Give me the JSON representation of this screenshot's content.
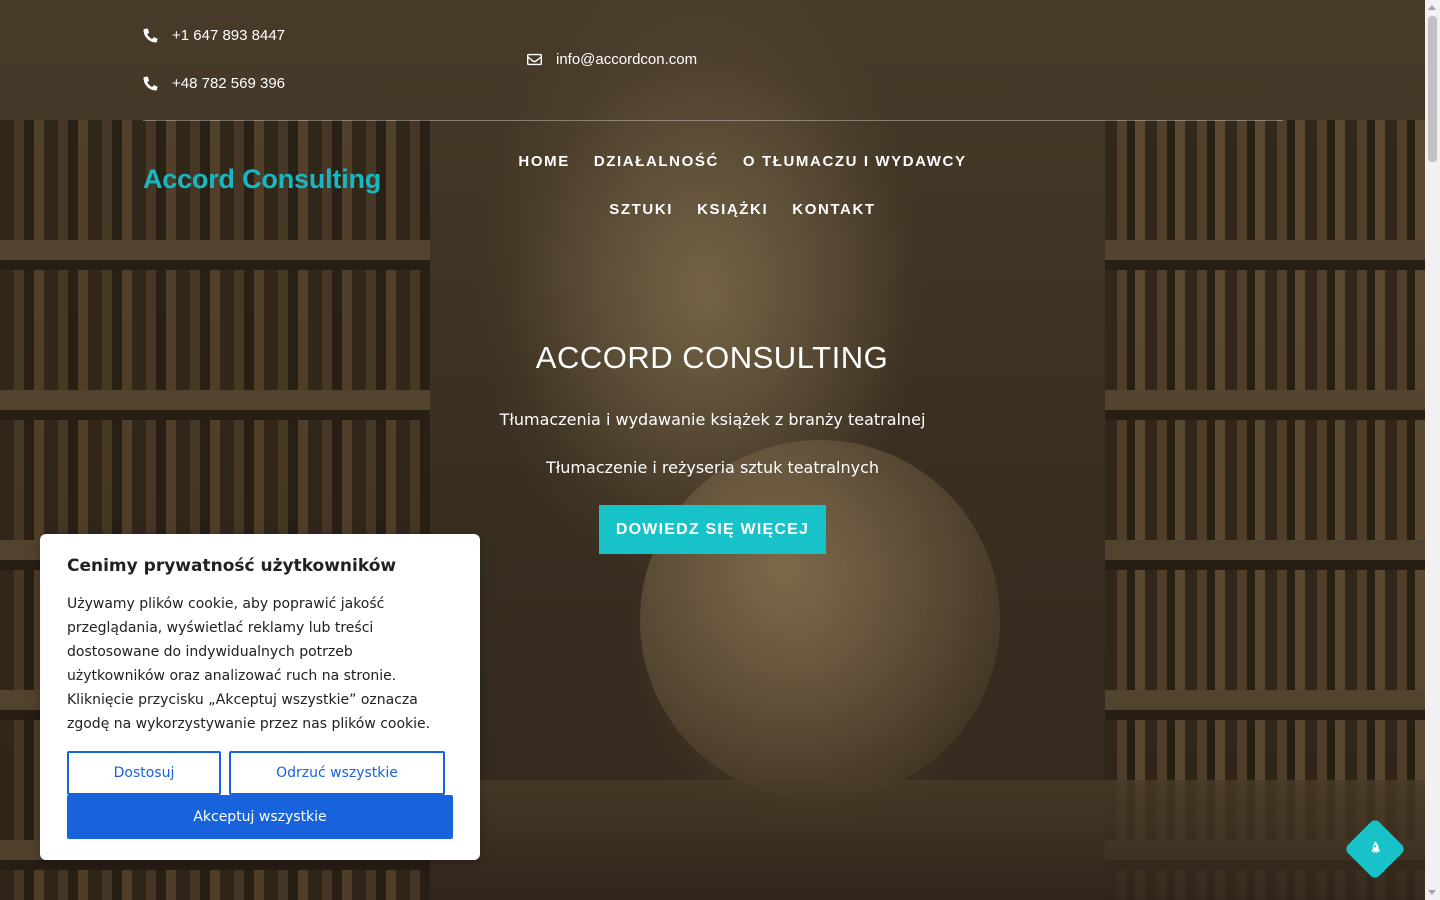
{
  "header": {
    "phone_1": "+1 647 893 8447",
    "phone_2": "+48 782 569 396",
    "email": "info@accordcon.com",
    "logo": "Accord Consulting"
  },
  "nav": {
    "items": [
      "HOME",
      "DZIAŁALNOŚĆ",
      "O TŁUMACZU I WYDAWCY",
      "SZTUKI",
      "KSIĄŻKI",
      "KONTAKT"
    ]
  },
  "hero": {
    "title": "ACCORD CONSULTING",
    "line_1": "Tłumaczenia i wydawanie książek z branży teatralnej",
    "line_2": "Tłumaczenie i reżyseria sztuk teatralnych",
    "button": "DOWIEDZ SIĘ WIĘCEJ"
  },
  "cookie_banner": {
    "title": "Cenimy prywatność użytkowników",
    "body": "Używamy plików cookie, aby poprawić jakość przeglądania, wyświetlać reklamy lub treści dostosowane do indywidualnych potrzeb użytkowników oraz analizować ruch na stronie. Kliknięcie przycisku „Akceptuj wszystkie” oznacza zgodę na wykorzystywanie przez nas plików cookie.",
    "customize": "Dostosuj",
    "reject": "Odrzuć wszystkie",
    "accept": "Akceptuj wszystkie"
  },
  "icons": {
    "phone": "phone-icon",
    "email": "envelope-icon",
    "scroll_top": "rocket-icon"
  },
  "colors": {
    "accent": "#17c2c9",
    "logo": "#17b8c2",
    "cookie_primary": "#1863dc"
  }
}
